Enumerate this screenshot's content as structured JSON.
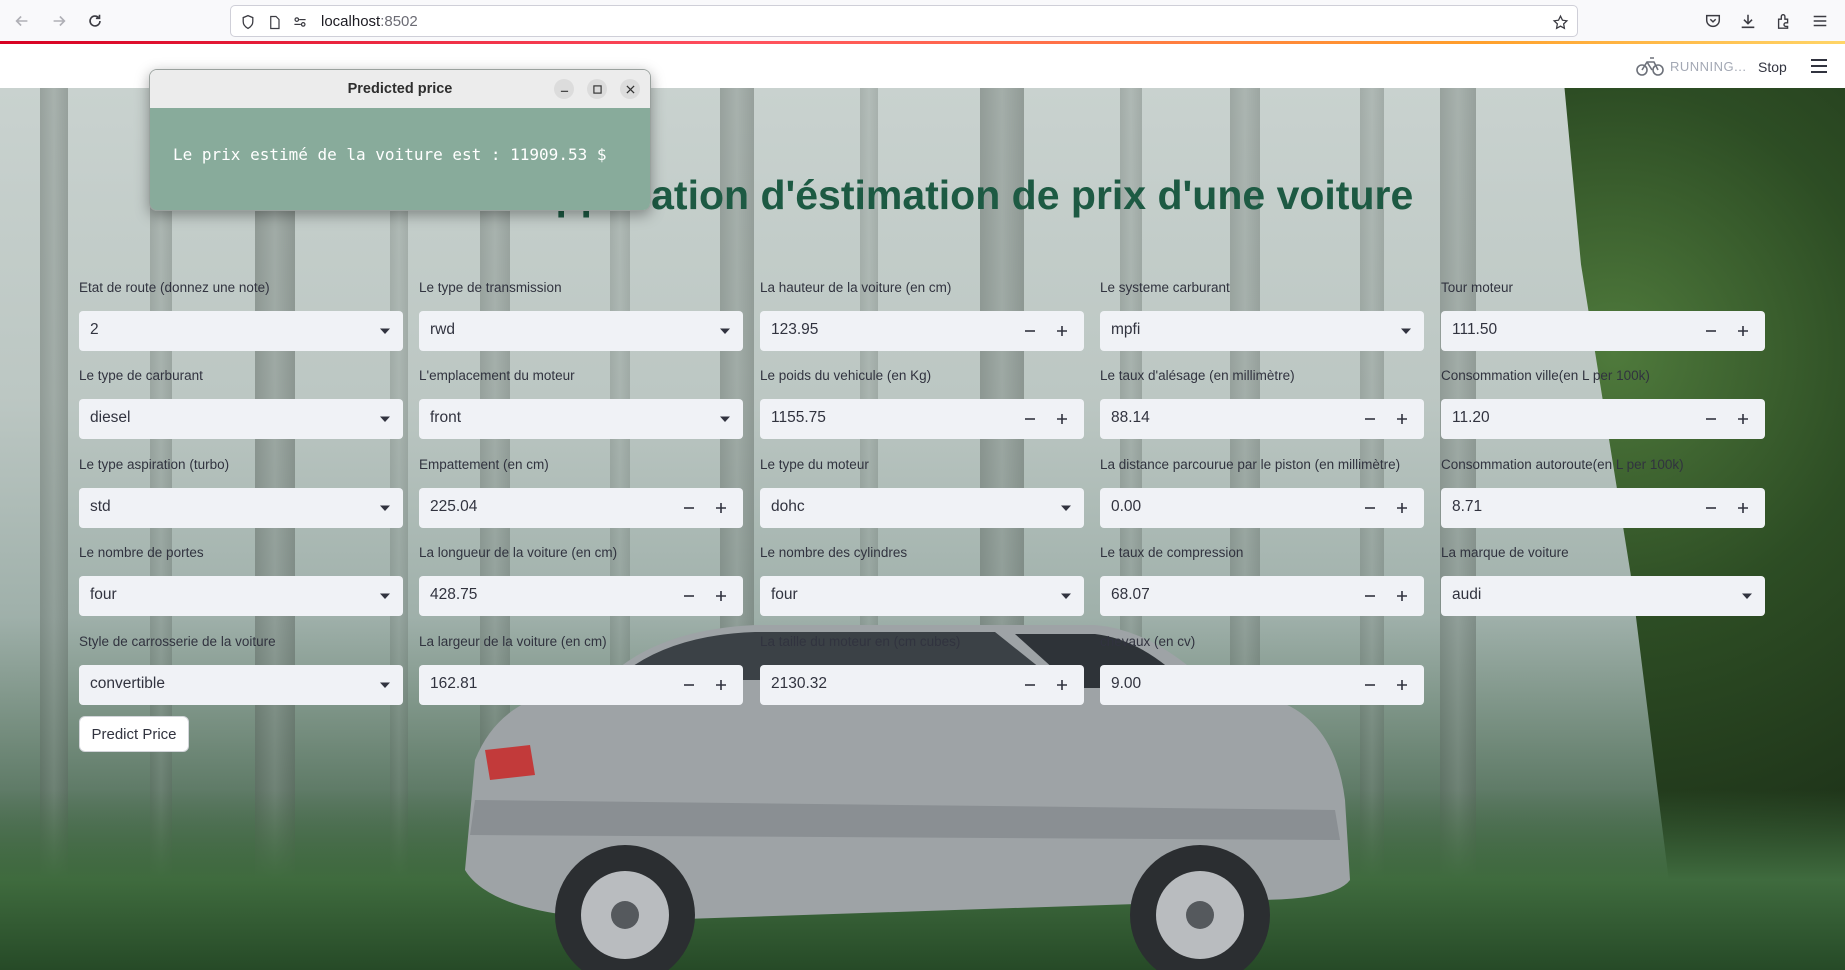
{
  "browser": {
    "url_host": "localhost",
    "url_port": ":8502"
  },
  "streamlit": {
    "status": "RUNNING...",
    "stop_label": "Stop"
  },
  "page": {
    "title": "Mon Application d'éstimation de prix d'une voiture"
  },
  "form": {
    "fields": [
      {
        "label": "Etat de route (donnez une note)",
        "value": "2",
        "type": "select"
      },
      {
        "label": "Le type de transmission",
        "value": "rwd",
        "type": "select"
      },
      {
        "label": "La hauteur de la voiture (en cm)",
        "value": "123.95",
        "type": "number"
      },
      {
        "label": "Le systeme carburant",
        "value": "mpfi",
        "type": "select"
      },
      {
        "label": "Tour moteur",
        "value": "111.50",
        "type": "number"
      },
      {
        "label": "Le type de carburant",
        "value": "diesel",
        "type": "select"
      },
      {
        "label": "L'emplacement du moteur",
        "value": "front",
        "type": "select"
      },
      {
        "label": "Le poids du vehicule (en Kg)",
        "value": "1155.75",
        "type": "number"
      },
      {
        "label": "Le taux d'alésage (en millimètre)",
        "value": "88.14",
        "type": "number"
      },
      {
        "label": "Consommation ville(en L per 100k)",
        "value": "11.20",
        "type": "number"
      },
      {
        "label": "Le type aspiration (turbo)",
        "value": "std",
        "type": "select"
      },
      {
        "label": "Empattement (en cm)",
        "value": "225.04",
        "type": "number"
      },
      {
        "label": "Le type du moteur",
        "value": "dohc",
        "type": "select"
      },
      {
        "label": "La distance parcourue par le piston (en millimètre)",
        "value": "0.00",
        "type": "number"
      },
      {
        "label": "Consommation autoroute(en L per 100k)",
        "value": "8.71",
        "type": "number"
      },
      {
        "label": "Le nombre de portes",
        "value": "four",
        "type": "select"
      },
      {
        "label": "La longueur de la voiture (en cm)",
        "value": "428.75",
        "type": "number"
      },
      {
        "label": "Le nombre des cylindres",
        "value": "four",
        "type": "select"
      },
      {
        "label": "Le taux de compression",
        "value": "68.07",
        "type": "number"
      },
      {
        "label": "La marque de voiture",
        "value": "audi",
        "type": "select"
      },
      {
        "label": "Style de carrosserie de la voiture",
        "value": "convertible",
        "type": "select"
      },
      {
        "label": "La largeur de la voiture (en cm)",
        "value": "162.81",
        "type": "number"
      },
      {
        "label": "La taille du moteur en (cm cubes)",
        "value": "2130.32",
        "type": "number"
      },
      {
        "label": "chevaux (en cv)",
        "value": "9.00",
        "type": "number"
      }
    ],
    "predict_label": "Predict Price"
  },
  "popup": {
    "title": "Predicted price",
    "message": "Le prix estimé de la voiture est : 11909.53 $"
  },
  "colors": {
    "title": "#1d5a43",
    "popup_body": "#88ab9b",
    "field_bg": "#f0f2f6"
  }
}
